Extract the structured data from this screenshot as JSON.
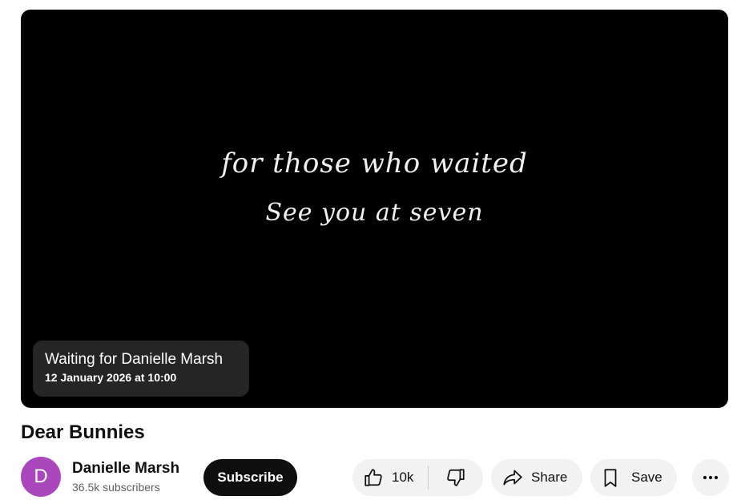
{
  "player": {
    "overlay_line1": "for those who waited",
    "overlay_line2": "See you at seven",
    "premiere_title": "Waiting for Danielle Marsh",
    "premiere_time": "12 January 2026 at 10:00"
  },
  "video": {
    "title": "Dear Bunnies"
  },
  "channel": {
    "avatar_letter": "D",
    "avatar_color": "#ab47bc",
    "name": "Danielle Marsh",
    "subscribers": "36.5k subscribers"
  },
  "actions": {
    "subscribe_label": "Subscribe",
    "like_count": "10k",
    "share_label": "Share",
    "save_label": "Save"
  },
  "icons": {
    "like": "thumbs-up-icon",
    "dislike": "thumbs-down-icon",
    "share": "share-arrow-icon",
    "save": "bookmark-icon",
    "more": "more-horizontal-icon"
  }
}
